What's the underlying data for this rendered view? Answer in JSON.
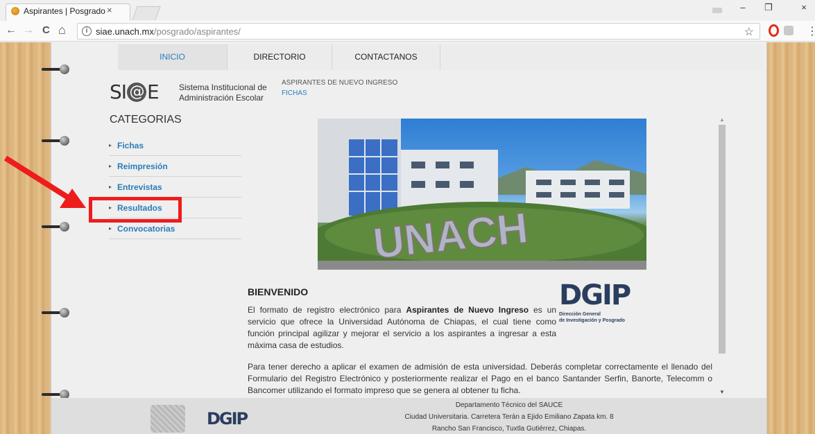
{
  "browser": {
    "tab_title": "Aspirantes | Posgrado",
    "tab_close": "×",
    "url_host": "siae.unach.mx",
    "url_path": "/posgrado/aspirantes/",
    "back_icon": "←",
    "forward_icon": "→",
    "reload_icon": "C",
    "home_icon": "⌂",
    "star_icon": "☆",
    "menu_icon": "⋮",
    "minimize": "–",
    "restore": "❐",
    "close": "×"
  },
  "site_nav": {
    "items": [
      "INICIO",
      "DIRECTORIO",
      "CONTACTANOS"
    ]
  },
  "logo": {
    "prefix": "SI",
    "at": "@",
    "suffix": "E",
    "line1": "Sistema Institucional de",
    "line2": "Administración Escolar"
  },
  "breadcrumb": {
    "title": "ASPIRANTES DE NUEVO INGRESO",
    "link": "FICHAS"
  },
  "categories": {
    "title": "CATEGORIAS",
    "items": [
      "Fichas",
      "Reimpresión",
      "Entrevistas",
      "Resultados",
      "Convocatorias"
    ]
  },
  "photo": {
    "lettering": "UNACH"
  },
  "welcome": {
    "title": "BIENVENIDO",
    "p1_a": "El formato de registro electrónico para ",
    "p1_bold": "Aspirantes de Nuevo Ingreso",
    "p1_b": " es un servicio que ofrece la Universidad Autónoma de Chiapas, el cual tiene como función principal agilizar y mejorar el servicio a los aspirantes a ingresar a esta máxima casa de estudios.",
    "p2": "Para tener derecho a aplicar el examen de admisión de esta universidad. Deberás completar correctamente el llenado del Formulario del Registro Electrónico y posteriormente realizar el Pago en el banco Santander Serfin, Banorte, Telecomm o Bancomer utilizando el formato impreso que se genera al obtener tu ficha."
  },
  "dgip": {
    "mark": "DGIP",
    "line1": "Dirección General",
    "line2": "de Investigación y Posgrado"
  },
  "footer": {
    "line1": "Departamento Técnico del SAUCE",
    "line2": "Ciudad Universitaria. Carretera Terán a Ejido Emiliano Zapata km. 8",
    "line3": "Rancho San Francisco, Tuxtla Gutiérrez, Chiapas.",
    "dgip_mark": "DGIP"
  },
  "colors": {
    "link_blue": "#2a7db8",
    "highlight_red": "#ee1c1c",
    "dgip_navy": "#2b3d5e"
  }
}
